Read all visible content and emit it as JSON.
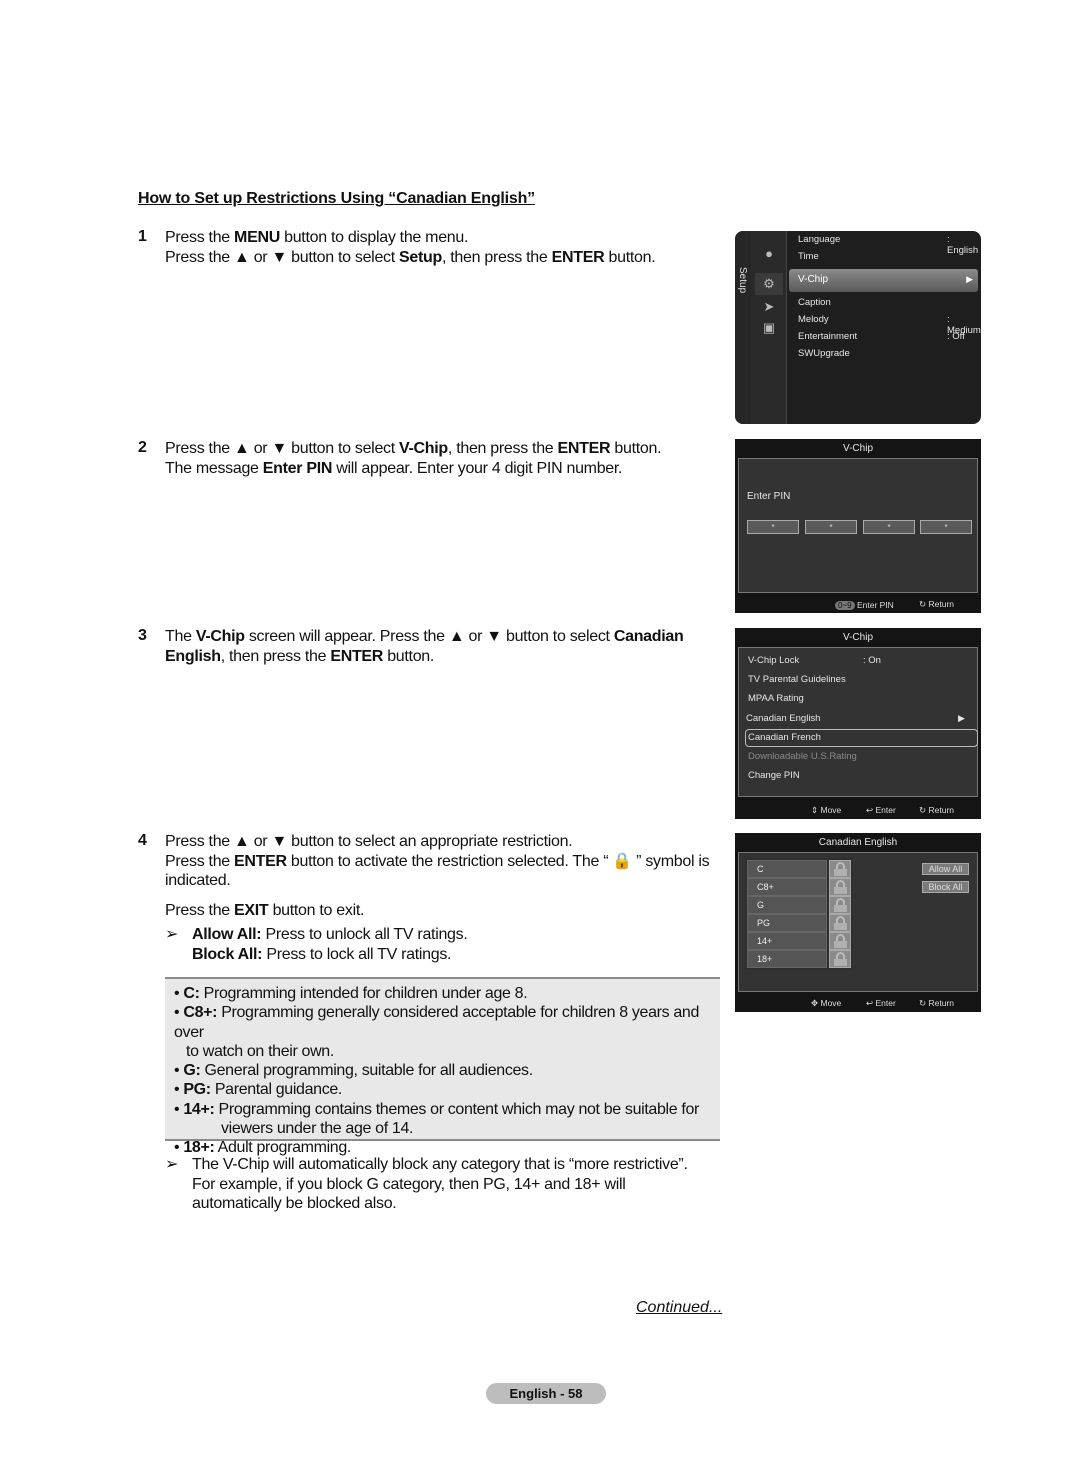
{
  "doc": {
    "title": "How to Set up Restrictions Using “Canadian English”",
    "steps": [
      {
        "num": "1",
        "lines": [
          [
            "Press the ",
            {
              "b": "MENU"
            },
            " button to display the menu."
          ],
          [
            "Press the ▲ or ▼ button to select ",
            {
              "b": "Setup"
            },
            ", then press the ",
            {
              "b": "ENTER"
            },
            " button."
          ]
        ]
      },
      {
        "num": "2",
        "lines": [
          [
            "Press the ▲ or ▼ button to select ",
            {
              "b": "V-Chip"
            },
            ", then press the ",
            {
              "b": "ENTER"
            },
            " button."
          ],
          [
            "The message ",
            {
              "b": "Enter PIN"
            },
            " will appear. Enter your 4 digit PIN number."
          ]
        ]
      },
      {
        "num": "3",
        "lines": [
          [
            "The ",
            {
              "b": "V-Chip"
            },
            " screen will appear. Press the ▲ or ▼ button to select ",
            {
              "b": "Canadian"
            }
          ],
          [
            {
              "b": "English"
            },
            ", then press the ",
            {
              "b": "ENTER"
            },
            " button."
          ]
        ]
      },
      {
        "num": "4",
        "lines": [
          [
            "Press the ▲ or ▼ button to select an appropriate restriction."
          ],
          [
            "Press the ",
            {
              "b": "ENTER"
            },
            " button to activate the restriction selected. The “ 🔒 ” symbol is"
          ],
          [
            "indicated."
          ]
        ],
        "exit_line": [
          "Press the ",
          {
            "b": "EXIT"
          },
          " button to exit."
        ],
        "note_lines": [
          [
            {
              "b": "Allow All:"
            },
            " Press to unlock all TV ratings."
          ],
          [
            {
              "b": "Block All:"
            },
            " Press to lock all TV ratings."
          ]
        ]
      }
    ],
    "ratings": [
      {
        "code": "C:",
        "text": " Programming intended for children under age 8."
      },
      {
        "code": "C8+:",
        "text": " Programming generally considered acceptable for children 8 years and over",
        "cont": "to watch on their own."
      },
      {
        "code": "G:",
        "text": " General programming, suitable for all audiences."
      },
      {
        "code": "PG:",
        "text": " Parental guidance."
      },
      {
        "code": "14+:",
        "text": " Programming contains themes or content which may not be suitable for",
        "cont2": "viewers under the age of 14."
      },
      {
        "code": "18+:",
        "text": " Adult programming."
      }
    ],
    "final_note": [
      "The V-Chip will automatically block any category that is “more restrictive”.",
      "For example, if you block G category, then PG, 14+ and 18+ will",
      "automatically be blocked also."
    ],
    "continued": "Continued...",
    "page_label": "English - 58",
    "note_arrow": "➢"
  },
  "screen1": {
    "side_label": "Setup",
    "items": [
      {
        "label": "Language",
        "value": ": English"
      },
      {
        "label": "Time",
        "value": ""
      },
      {
        "label": "V-Chip",
        "value": "",
        "selected": true
      },
      {
        "label": "Caption",
        "value": ""
      },
      {
        "label": "Melody",
        "value": ": Medium"
      },
      {
        "label": "Entertainment",
        "value": ": Off"
      },
      {
        "label": "SWUpgrade",
        "value": ""
      }
    ],
    "selected_arrow": "▶"
  },
  "screen2": {
    "title": "V-Chip",
    "prompt": "Enter PIN",
    "pin_mask": [
      "*",
      "*",
      "*",
      "*"
    ],
    "footer_key": "0~9",
    "footer_enter": "Enter PIN",
    "footer_return": "Return"
  },
  "screen3": {
    "title": "V-Chip",
    "items": [
      {
        "label": "V-Chip Lock",
        "value": ": On"
      },
      {
        "label": "TV Parental Guidelines"
      },
      {
        "label": "MPAA Rating"
      },
      {
        "label": "Canadian English",
        "selected": true
      },
      {
        "label": "Canadian French"
      },
      {
        "label": "Downloadable U.S.Rating",
        "disabled": true
      },
      {
        "label": "Change PIN"
      }
    ],
    "selected_arrow": "▶",
    "footer_move": "Move",
    "footer_enter": "Enter",
    "footer_return": "Return"
  },
  "screen4": {
    "title": "Canadian English",
    "ratings": [
      "C",
      "C8+",
      "G",
      "PG",
      "14+",
      "18+"
    ],
    "allow_all": "Allow All",
    "block_all": "Block All",
    "footer_move": "Move",
    "footer_enter": "Enter",
    "footer_return": "Return"
  }
}
